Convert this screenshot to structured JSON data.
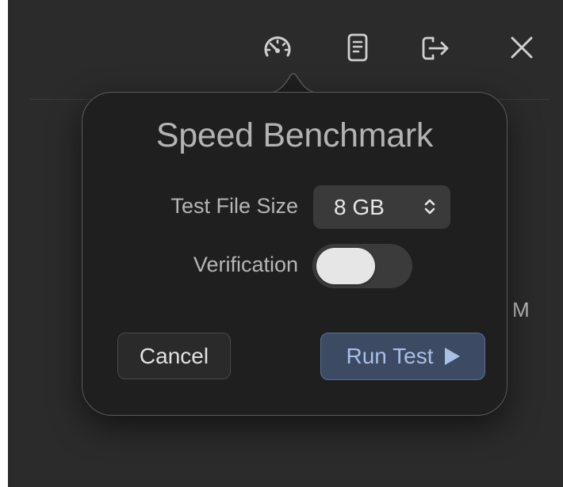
{
  "popover": {
    "title": "Speed Benchmark",
    "file_size_label": "Test File Size",
    "file_size_value": "8 GB",
    "verification_label": "Verification",
    "verification_enabled": false,
    "cancel_label": "Cancel",
    "run_label": "Run Test"
  },
  "toolbar": {
    "icons": [
      "speedometer-icon",
      "document-icon",
      "export-icon",
      "close-icon"
    ]
  },
  "background": {
    "partial_text": "M"
  },
  "colors": {
    "window_bg": "#2b2b2b",
    "popover_bg": "#1f1f1f",
    "accent_button_bg": "#3d4a63",
    "accent_text": "#a8bfe6"
  }
}
